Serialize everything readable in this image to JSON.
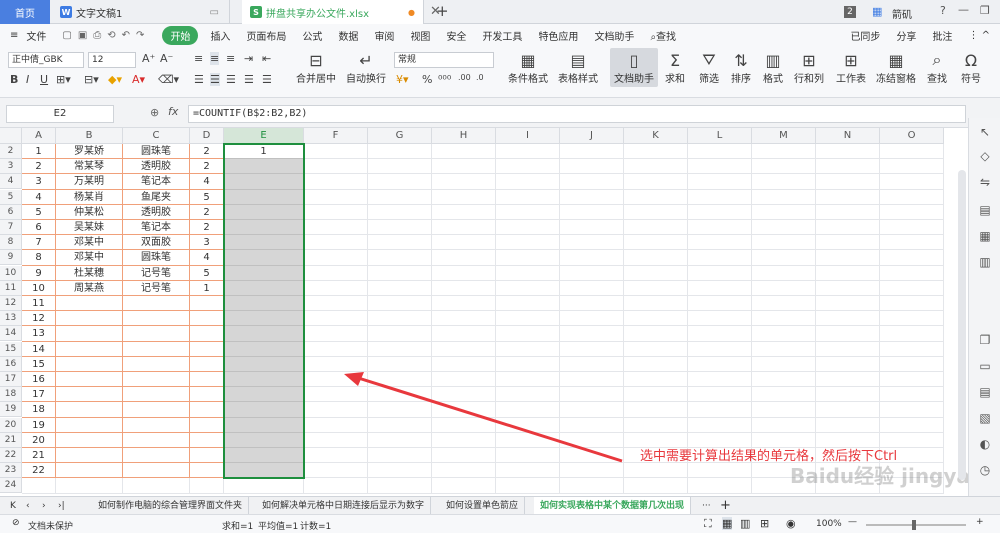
{
  "tabs": {
    "home": "首页",
    "doc1": "文字文稿1",
    "doc2": "拼盘共享办公文件.xlsx",
    "badge": "2",
    "user": "箭矶"
  },
  "menu": [
    "文件",
    "开始",
    "插入",
    "页面布局",
    "公式",
    "数据",
    "审阅",
    "视图",
    "安全",
    "开发工具",
    "特色应用",
    "文档助手",
    "查找"
  ],
  "menu_right": [
    "已同步",
    "分享",
    "批注"
  ],
  "ribbon": {
    "font_name": "正中倩_GBK",
    "font_size": "12",
    "number_format": "常规",
    "merge_center": "合并居中",
    "auto_wrap": "自动换行",
    "cond_format": "条件格式",
    "table_style": "表格样式",
    "doc_helper": "文档助手",
    "sum": "求和",
    "filter": "筛选",
    "sort": "排序",
    "format": "格式",
    "row_col": "行和列",
    "worksheet": "工作表",
    "freeze": "冻结窗格",
    "find": "查找",
    "symbol": "符号"
  },
  "formula_bar": {
    "name_box": "E2",
    "fx": "fx",
    "formula": "=COUNTIF(B$2:B2,B2)"
  },
  "columns": [
    "A",
    "B",
    "C",
    "D",
    "E",
    "F",
    "G",
    "H",
    "I",
    "J",
    "K",
    "L",
    "M",
    "N",
    "O"
  ],
  "rows": [
    {
      "num": "2",
      "a": "1",
      "b": "罗某娇",
      "c": "圆珠笔",
      "d": "2",
      "e": "1"
    },
    {
      "num": "3",
      "a": "2",
      "b": "常某琴",
      "c": "透明胶",
      "d": "2",
      "e": ""
    },
    {
      "num": "4",
      "a": "3",
      "b": "万某明",
      "c": "笔记本",
      "d": "4",
      "e": ""
    },
    {
      "num": "5",
      "a": "4",
      "b": "杨某肖",
      "c": "鱼尾夹",
      "d": "5",
      "e": ""
    },
    {
      "num": "6",
      "a": "5",
      "b": "仲某松",
      "c": "透明胶",
      "d": "2",
      "e": ""
    },
    {
      "num": "7",
      "a": "6",
      "b": "吴某妹",
      "c": "笔记本",
      "d": "2",
      "e": ""
    },
    {
      "num": "8",
      "a": "7",
      "b": "邓某中",
      "c": "双面胶",
      "d": "3",
      "e": ""
    },
    {
      "num": "9",
      "a": "8",
      "b": "邓某中",
      "c": "圆珠笔",
      "d": "4",
      "e": ""
    },
    {
      "num": "10",
      "a": "9",
      "b": "杜某穗",
      "c": "记号笔",
      "d": "5",
      "e": ""
    },
    {
      "num": "11",
      "a": "10",
      "b": "周某燕",
      "c": "记号笔",
      "d": "1",
      "e": ""
    },
    {
      "num": "12",
      "a": "11",
      "b": "",
      "c": "",
      "d": "",
      "e": ""
    },
    {
      "num": "13",
      "a": "12",
      "b": "",
      "c": "",
      "d": "",
      "e": ""
    },
    {
      "num": "14",
      "a": "13",
      "b": "",
      "c": "",
      "d": "",
      "e": ""
    },
    {
      "num": "15",
      "a": "14",
      "b": "",
      "c": "",
      "d": "",
      "e": ""
    },
    {
      "num": "16",
      "a": "15",
      "b": "",
      "c": "",
      "d": "",
      "e": ""
    },
    {
      "num": "17",
      "a": "16",
      "b": "",
      "c": "",
      "d": "",
      "e": ""
    },
    {
      "num": "18",
      "a": "17",
      "b": "",
      "c": "",
      "d": "",
      "e": ""
    },
    {
      "num": "19",
      "a": "18",
      "b": "",
      "c": "",
      "d": "",
      "e": ""
    },
    {
      "num": "20",
      "a": "19",
      "b": "",
      "c": "",
      "d": "",
      "e": ""
    },
    {
      "num": "21",
      "a": "20",
      "b": "",
      "c": "",
      "d": "",
      "e": ""
    },
    {
      "num": "22",
      "a": "21",
      "b": "",
      "c": "",
      "d": "",
      "e": ""
    },
    {
      "num": "23",
      "a": "22",
      "b": "",
      "c": "",
      "d": "",
      "e": ""
    },
    {
      "num": "24",
      "a": "",
      "b": "",
      "c": "",
      "d": "",
      "e": ""
    }
  ],
  "annotation": "选中需要计算出结果的单元格，然后按下Ctrl",
  "watermark": "Baidu经验 jingyan.baidu.com",
  "sheet_tabs": [
    "如何制作电脑的综合管理界面文件夹",
    "如何解决单元格中日期连接后显示为数字",
    "如何设置单色箭应",
    "如何实现表格中某个数据第几次出现"
  ],
  "status": {
    "protect": "文档未保护",
    "sum": "求和=1",
    "avg": "平均值=1",
    "count": "计数=1",
    "zoom": "100%"
  },
  "colors": {
    "accent": "#3aa85d",
    "selection": "#1e8f3e",
    "arrow": "#e8383d",
    "annotation": "#e8383d"
  }
}
